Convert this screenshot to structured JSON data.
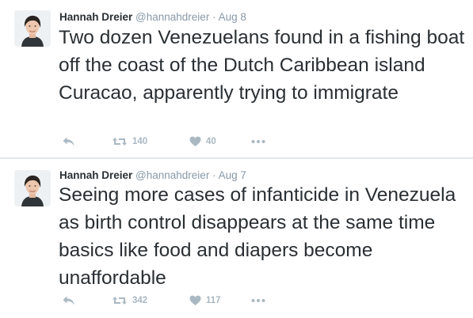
{
  "colors": {
    "text": "#292f33",
    "secondary": "#8899a6",
    "action": "#aab8c2",
    "divider": "#e1e8ed"
  },
  "tweets": [
    {
      "fullname": "Hannah Dreier",
      "username": "@hannahdreier",
      "separator": "·",
      "timestamp": "Aug 8",
      "text": "Two dozen Venezuelans found in a fishing boat off the coast of the Dutch Caribbean island Curacao, apparently trying to immigrate",
      "retweets": "140",
      "likes": "40",
      "icons": [
        "avatar",
        "reply-icon",
        "retweet-icon",
        "heart-icon",
        "more-icon"
      ]
    },
    {
      "fullname": "Hannah Dreier",
      "username": "@hannahdreier",
      "separator": "·",
      "timestamp": "Aug 7",
      "text": "Seeing more cases of infanticide in Venezuela as birth control disappears at the same time basics like food and diapers become unaffordable",
      "retweets": "342",
      "likes": "117",
      "icons": [
        "avatar",
        "reply-icon",
        "retweet-icon",
        "heart-icon",
        "more-icon"
      ]
    }
  ]
}
